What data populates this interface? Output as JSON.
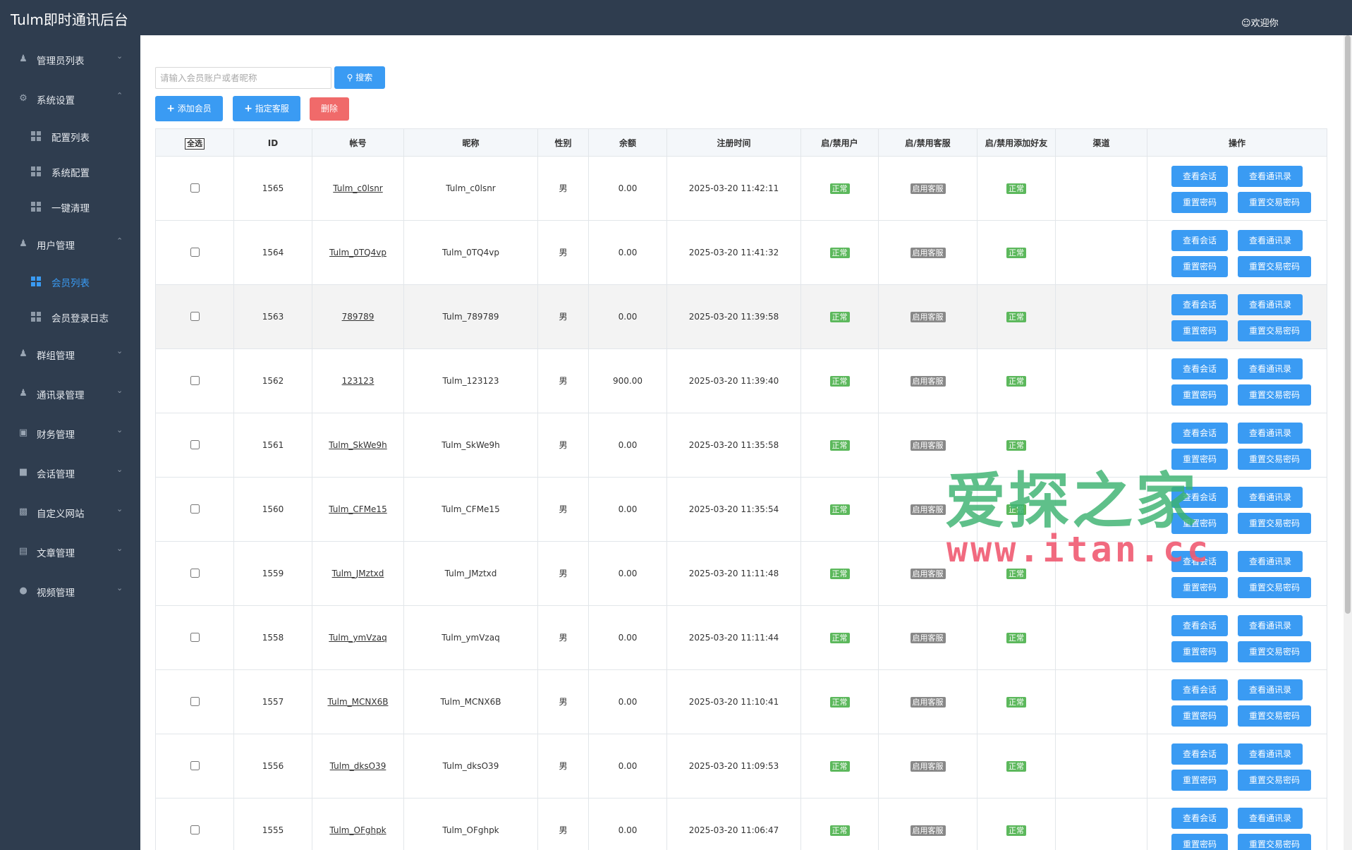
{
  "header": {
    "title": "Tulm即时通讯后台",
    "welcome": "欢迎你"
  },
  "sidebar": {
    "items": [
      {
        "label": "管理员列表",
        "icon": "user-icon",
        "caret": "down"
      },
      {
        "label": "系统设置",
        "icon": "gear-icon",
        "caret": "up"
      },
      {
        "label": "配置列表",
        "icon": "grid-icon",
        "sub": true
      },
      {
        "label": "系统配置",
        "icon": "grid-icon",
        "sub": true
      },
      {
        "label": "一键清理",
        "icon": "grid-icon",
        "sub": true
      },
      {
        "label": "用户管理",
        "icon": "user-icon",
        "caret": "up"
      },
      {
        "label": "会员列表",
        "icon": "grid-icon",
        "sub": true,
        "active": true
      },
      {
        "label": "会员登录日志",
        "icon": "grid-icon",
        "sub": true
      },
      {
        "label": "群组管理",
        "icon": "group-icon",
        "caret": "down"
      },
      {
        "label": "通讯录管理",
        "icon": "user-icon",
        "caret": "down"
      },
      {
        "label": "财务管理",
        "icon": "wallet-icon",
        "caret": "down"
      },
      {
        "label": "会话管理",
        "icon": "chat-icon",
        "caret": "down"
      },
      {
        "label": "自定义网站",
        "icon": "monitor-icon",
        "caret": "down"
      },
      {
        "label": "文章管理",
        "icon": "article-icon",
        "caret": "down"
      },
      {
        "label": "视频管理",
        "icon": "camera-icon",
        "caret": "down"
      }
    ]
  },
  "toolbar": {
    "search_placeholder": "请输入会员账户或者昵称",
    "search_label": "搜索",
    "add_label": "添加会员",
    "assign_label": "指定客服",
    "delete_label": "删除"
  },
  "table": {
    "select_all": "全选",
    "headers": [
      "ID",
      "帐号",
      "昵称",
      "性别",
      "余额",
      "注册时间",
      "启/禁用户",
      "启/禁用客服",
      "启/禁用添加好友",
      "渠道",
      "操作"
    ],
    "status_normal": "正常",
    "status_service": "启用客服",
    "actions": [
      "查看会话",
      "查看通讯录",
      "重置密码",
      "重置交易密码"
    ],
    "rows": [
      {
        "id": "1565",
        "account": "Tulm_c0lsnr",
        "nickname": "Tulm_c0lsnr",
        "gender": "男",
        "balance": "0.00",
        "time": "2025-03-20 11:42:11",
        "channel": ""
      },
      {
        "id": "1564",
        "account": "Tulm_0TQ4vp",
        "nickname": "Tulm_0TQ4vp",
        "gender": "男",
        "balance": "0.00",
        "time": "2025-03-20 11:41:32",
        "channel": ""
      },
      {
        "id": "1563",
        "account": "789789",
        "nickname": "Tulm_789789",
        "gender": "男",
        "balance": "0.00",
        "time": "2025-03-20 11:39:58",
        "channel": ""
      },
      {
        "id": "1562",
        "account": "123123",
        "nickname": "Tulm_123123",
        "gender": "男",
        "balance": "900.00",
        "time": "2025-03-20 11:39:40",
        "channel": ""
      },
      {
        "id": "1561",
        "account": "Tulm_SkWe9h",
        "nickname": "Tulm_SkWe9h",
        "gender": "男",
        "balance": "0.00",
        "time": "2025-03-20 11:35:58",
        "channel": ""
      },
      {
        "id": "1560",
        "account": "Tulm_CFMe15",
        "nickname": "Tulm_CFMe15",
        "gender": "男",
        "balance": "0.00",
        "time": "2025-03-20 11:35:54",
        "channel": ""
      },
      {
        "id": "1559",
        "account": "Tulm_JMztxd",
        "nickname": "Tulm_JMztxd",
        "gender": "男",
        "balance": "0.00",
        "time": "2025-03-20 11:11:48",
        "channel": ""
      },
      {
        "id": "1558",
        "account": "Tulm_ymVzaq",
        "nickname": "Tulm_ymVzaq",
        "gender": "男",
        "balance": "0.00",
        "time": "2025-03-20 11:11:44",
        "channel": ""
      },
      {
        "id": "1557",
        "account": "Tulm_MCNX6B",
        "nickname": "Tulm_MCNX6B",
        "gender": "男",
        "balance": "0.00",
        "time": "2025-03-20 11:10:41",
        "channel": ""
      },
      {
        "id": "1556",
        "account": "Tulm_dksO39",
        "nickname": "Tulm_dksO39",
        "gender": "男",
        "balance": "0.00",
        "time": "2025-03-20 11:09:53",
        "channel": ""
      },
      {
        "id": "1555",
        "account": "Tulm_OFghpk",
        "nickname": "Tulm_OFghpk",
        "gender": "男",
        "balance": "0.00",
        "time": "2025-03-20 11:06:47",
        "channel": ""
      }
    ]
  },
  "watermark": {
    "line1": "爱探之家",
    "line2": "www.itan.cc"
  },
  "colors": {
    "sidebar": "#2f3d4f",
    "accent": "#3a9bf3",
    "danger": "#f06a6a",
    "ok": "#5cb85c",
    "muted": "#888888"
  }
}
